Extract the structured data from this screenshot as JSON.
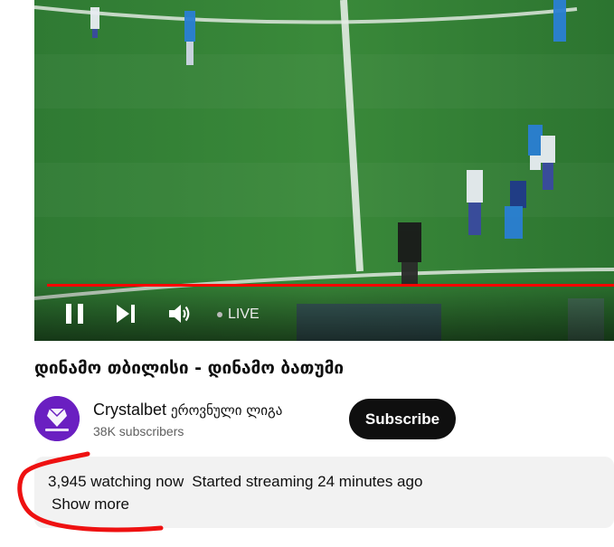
{
  "player": {
    "live_label": "LIVE",
    "progress_color": "#ff0000",
    "icons": [
      "pause-icon",
      "next-icon",
      "volume-icon"
    ]
  },
  "video": {
    "title": "დინამო თბილისი - დინამო ბათუმი"
  },
  "channel": {
    "name": "Crystalbet",
    "subtitle": "ეროვნული ლიგა",
    "subscribers": "38K subscribers",
    "avatar_color": "#6a1fc1"
  },
  "subscribe": {
    "label": "Subscribe"
  },
  "description": {
    "watching": "3,945 watching now",
    "started": "Started streaming 24 minutes ago",
    "show_more": "Show more"
  },
  "annotation": {
    "color": "#ee1111"
  }
}
